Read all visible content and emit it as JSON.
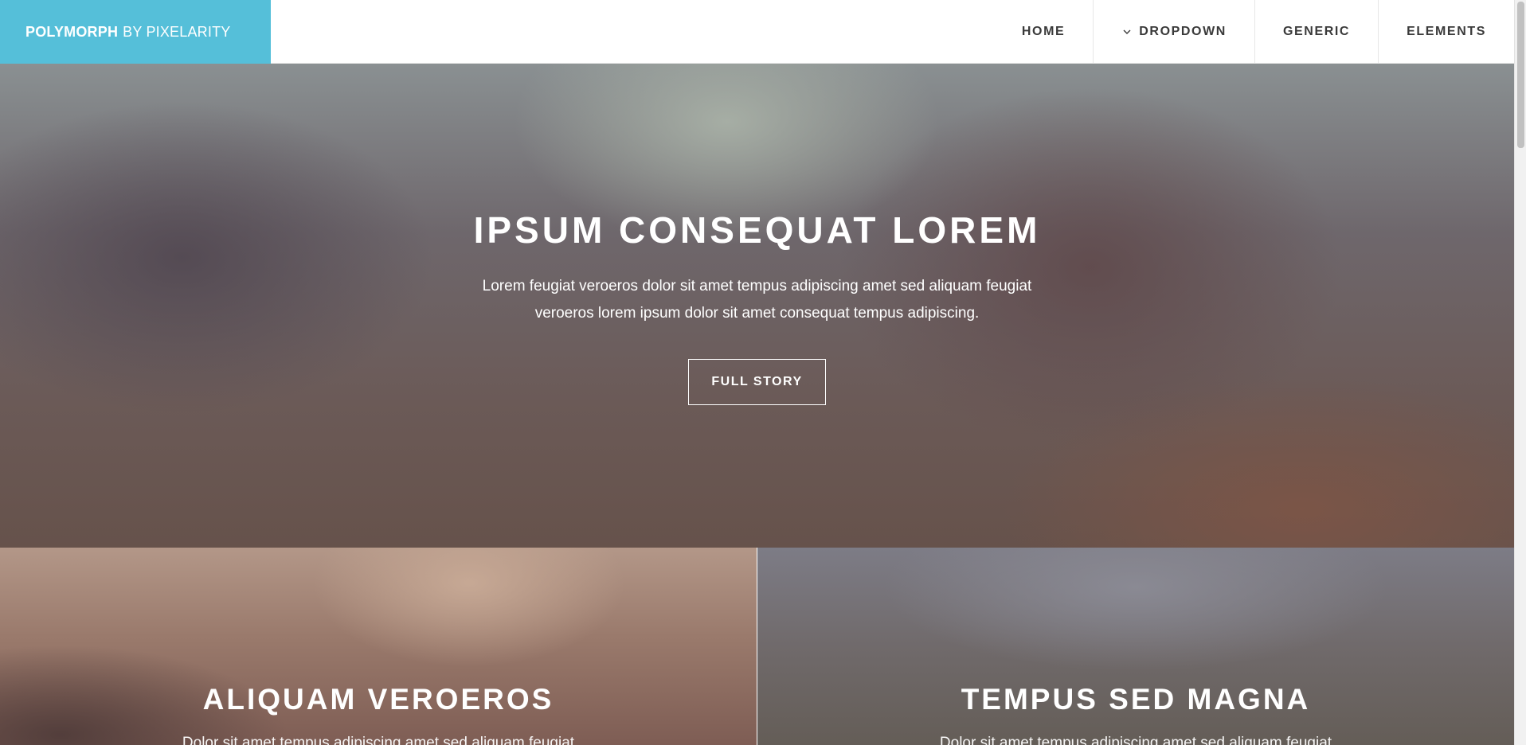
{
  "brand": {
    "name_strong": "POLYMORPH",
    "name_light": "BY PIXELARITY"
  },
  "nav": {
    "items": [
      {
        "label": "HOME"
      },
      {
        "label": "DROPDOWN",
        "icon": "chevron-down-icon"
      },
      {
        "label": "GENERIC"
      },
      {
        "label": "ELEMENTS"
      }
    ]
  },
  "hero": {
    "title": "IPSUM CONSEQUAT LOREM",
    "text": "Lorem feugiat veroeros dolor sit amet tempus adipiscing amet sed aliquam feugiat veroeros lorem ipsum dolor sit amet consequat tempus adipiscing.",
    "button_label": "FULL STORY"
  },
  "features": [
    {
      "title": "ALIQUAM VEROEROS",
      "text": "Dolor sit amet tempus adipiscing amet sed aliquam feugiat"
    },
    {
      "title": "TEMPUS SED MAGNA",
      "text": "Dolor sit amet tempus adipiscing amet sed aliquam feugiat"
    }
  ],
  "colors": {
    "brand_bg": "#55bfd9",
    "nav_text": "#3a3a3a",
    "hero_text": "#ffffff"
  }
}
